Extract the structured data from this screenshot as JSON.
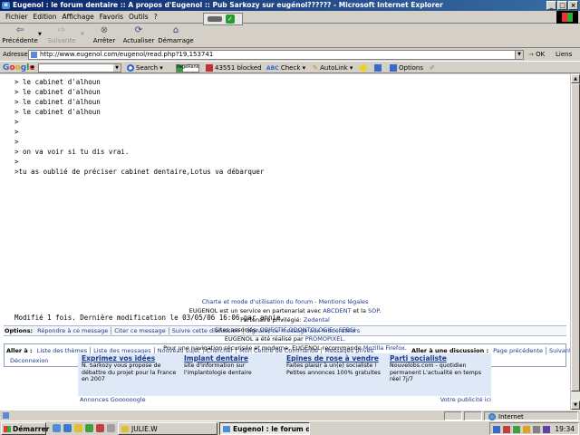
{
  "window": {
    "title": "Eugenol : le forum dentaire :: A propos d'Eugenol :: Pub Sarkozy sur eugénol?????? - Microsoft Internet Explorer"
  },
  "menu": [
    "Fichier",
    "Edition",
    "Affichage",
    "Favoris",
    "Outils",
    "?"
  ],
  "toolbar": {
    "back": "Précédente",
    "forward": "Suivante",
    "stop": "Arrêter",
    "refresh": "Actualiser",
    "home": "Démarrage"
  },
  "address": {
    "label": "Adresse",
    "url": "http://www.eugenol.com/eugenol/read.php?19,153741",
    "go": "OK",
    "links": "Liens"
  },
  "google": {
    "logo": [
      "G",
      "o",
      "o",
      "g",
      "l",
      "e"
    ],
    "search": "Search",
    "pagerank": "PageRank",
    "blocked": "43551 blocked",
    "check": "Check",
    "autolink": "AutoLink",
    "options": "Options"
  },
  "message": {
    "lines": [
      "> le cabinet d'alhoun",
      "> le cabinet d'alhoun",
      "> le cabinet d'alhoun",
      "> le cabinet d'alhoun",
      ">",
      ">",
      ">",
      "> on va voir si tu dis vrai.",
      ">",
      ">tu as oublié de préciser cabinet dentaire,Lotus va débarquer"
    ],
    "modified": "Modifié 1 fois. Dernière modification le 03/05/06 16:06 par annie."
  },
  "options": {
    "label": "Options:",
    "links": [
      "Répondre à ce message",
      "Citer ce message",
      "Suivre cette discussion",
      "Signaler ce message aux modérateurs"
    ]
  },
  "nav": {
    "goto_label": "Aller à :",
    "links": [
      "Liste des thèmes",
      "Liste des messages",
      "Nouveau sujet",
      "Chercher",
      "Mon Centre de Commande",
      "Messages privés"
    ],
    "logout": "Déconnexion",
    "discussion_label": "Aller à une discussion :",
    "prev": "Page précédente",
    "next": "Suivante"
  },
  "footer": {
    "charte": "Charte et mode d'utilisation du forum - Mentions légales",
    "line2_pre": "EUGENOL est un service en partenariat avec ",
    "abcdent": "ABCDENT",
    "line2_mid": " et la ",
    "sop": "SOP",
    "line2_post": ".",
    "line3_pre": "Partenaire privilégié: ",
    "zedental": "Zedental",
    "line4_pre": "Sites associés: ",
    "sites": "OBJECTIF ODONTOLOGIE - SFBSI",
    "line5_pre": "EUGENOL a été réalisé par ",
    "promopixel": "PROMOPIXEL",
    "line5_post": ".",
    "line6_pre": "Pour une navigation sécurisée et moderne, EUGENOL recommande ",
    "firefox": "Mozilla Firefox",
    "line6_post": "."
  },
  "ads": [
    {
      "title": "Exprimez vos idées",
      "text": "N. Sarkozy vous propose de débattre du projet pour la France en 2007"
    },
    {
      "title": "Implant dentaire",
      "text": "site d'information sur l'implantologie dentaire"
    },
    {
      "title": "Epines de rose à vendre",
      "text": "Faites plaisir à un(e) socialiste ! Petites annonces 100% gratuites"
    },
    {
      "title": "Parti socialiste",
      "text": "Nouvelobs.com - quotidien permanent L'actualité en temps réel 7j/7"
    }
  ],
  "ads_footer": {
    "left": "Annonces Goooooogle",
    "right": "Votre publicité ici"
  },
  "status": {
    "zone": "Internet"
  },
  "taskbar": {
    "start": "Démarrer",
    "tasks": [
      "JULIE.W",
      "Eugenol : le forum de..."
    ],
    "clock": "19:34"
  },
  "colors": {
    "titlebar": "#0a246a",
    "link": "#1a3a8a",
    "ad_bg": "#dfe8f6"
  }
}
